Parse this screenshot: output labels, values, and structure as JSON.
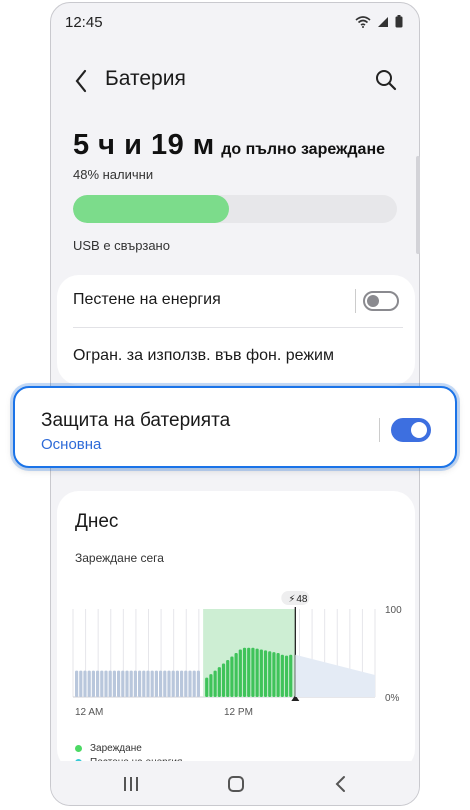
{
  "status_bar": {
    "time": "12:45",
    "icons": [
      "wifi-icon",
      "signal-icon",
      "battery-icon"
    ]
  },
  "header": {
    "title": "Батерия",
    "back_icon": "back-arrow-icon",
    "search_icon": "search-icon"
  },
  "battery": {
    "time_value": "5 ч и 19 м",
    "time_suffix": "до пълно зареждане",
    "available": "48% налични",
    "level_percent": 48,
    "bar_color": "#7cdc8b",
    "connection": "USB е свързано"
  },
  "settings": {
    "power_saving_label": "Пестене на енергия",
    "power_saving_on": false,
    "background_limit_label": "Огран. за използв. във фон. режим"
  },
  "protection": {
    "title": "Защита на батерията",
    "subtitle": "Основна",
    "enabled": true,
    "accent": "#3d6fe0"
  },
  "usage": {
    "heading": "Днес",
    "charging_label": "Зареждане сега",
    "legend": [
      {
        "label": "Зареждане",
        "color": "#4cd964"
      },
      {
        "label": "Пестене на енергия",
        "color": "#3ac9d6"
      }
    ]
  },
  "chart_data": {
    "type": "bar",
    "x_ticks": [
      "12 AM",
      "12 PM"
    ],
    "y_ticks": [
      "100",
      "0%"
    ],
    "ylim": [
      0,
      100
    ],
    "current_marker": "48",
    "past_values": [
      30,
      30,
      30,
      30,
      30,
      30,
      30,
      30,
      30,
      30,
      30,
      30,
      30,
      30,
      30,
      30,
      30,
      30,
      30,
      30,
      30,
      30,
      30,
      30,
      30,
      30,
      30,
      30,
      30,
      30
    ],
    "charging_values": [
      22,
      26,
      30,
      34,
      38,
      42,
      46,
      50,
      54,
      56,
      56,
      56,
      55,
      54,
      53,
      52,
      51,
      50,
      48,
      47,
      48
    ],
    "projection_end": 25
  },
  "nav": {
    "recent_icon": "recent-apps-icon",
    "home_icon": "home-icon",
    "back_icon": "back-icon"
  }
}
